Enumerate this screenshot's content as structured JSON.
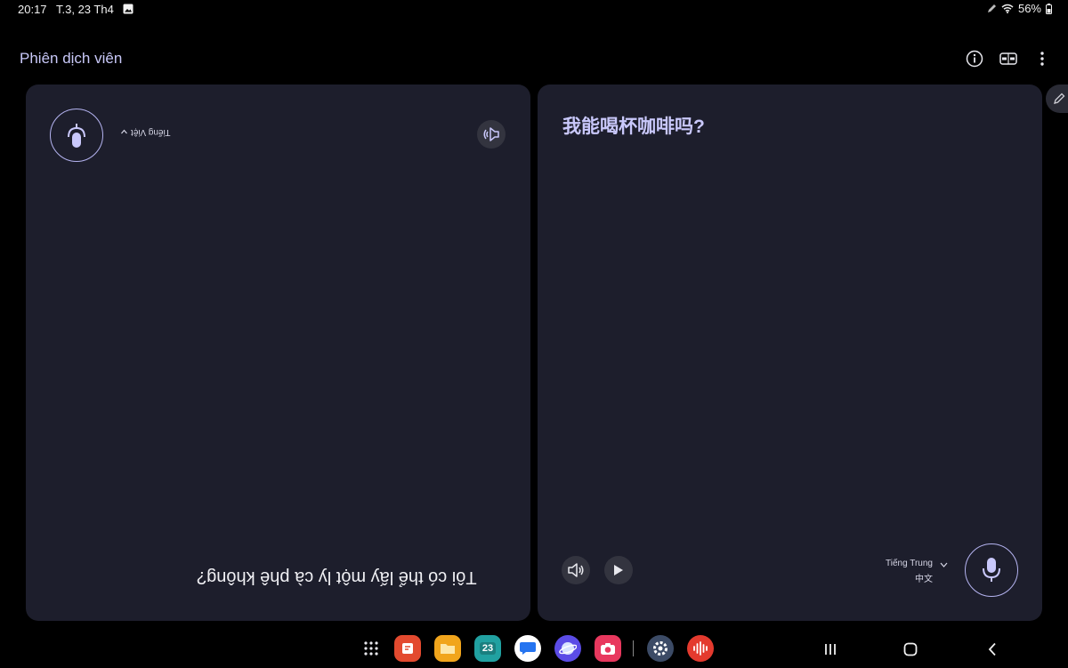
{
  "status_bar": {
    "time": "20:17",
    "date": "T.3, 23 Th4",
    "battery": "56%",
    "icons": [
      "image-icon",
      "pen-icon",
      "wifi-icon",
      "battery-icon"
    ]
  },
  "app": {
    "title": "Phiên dịch viên",
    "actions": [
      "info-icon",
      "layout-icon",
      "more-icon"
    ]
  },
  "left_panel": {
    "language": "Tiếng Việt",
    "text": "Tôi có thể lấy một ly cà phê không?"
  },
  "right_panel": {
    "text": "我能喝杯咖啡吗?",
    "language": "Tiếng Trung",
    "language_sub": "中文"
  },
  "colors": {
    "panel_bg": "#1d1e2c",
    "accent": "#c9c8fb",
    "background": "#000000"
  },
  "dock": {
    "apps": [
      "apps-grid-icon",
      "notes-app-icon",
      "files-app-icon",
      "calendar-app-icon",
      "messages-app-icon",
      "internet-app-icon",
      "camera-app-icon",
      "settings-app-icon",
      "voice-recorder-app-icon"
    ],
    "calendar_day": "23",
    "nav": [
      "recents-icon",
      "home-icon",
      "back-icon"
    ]
  }
}
